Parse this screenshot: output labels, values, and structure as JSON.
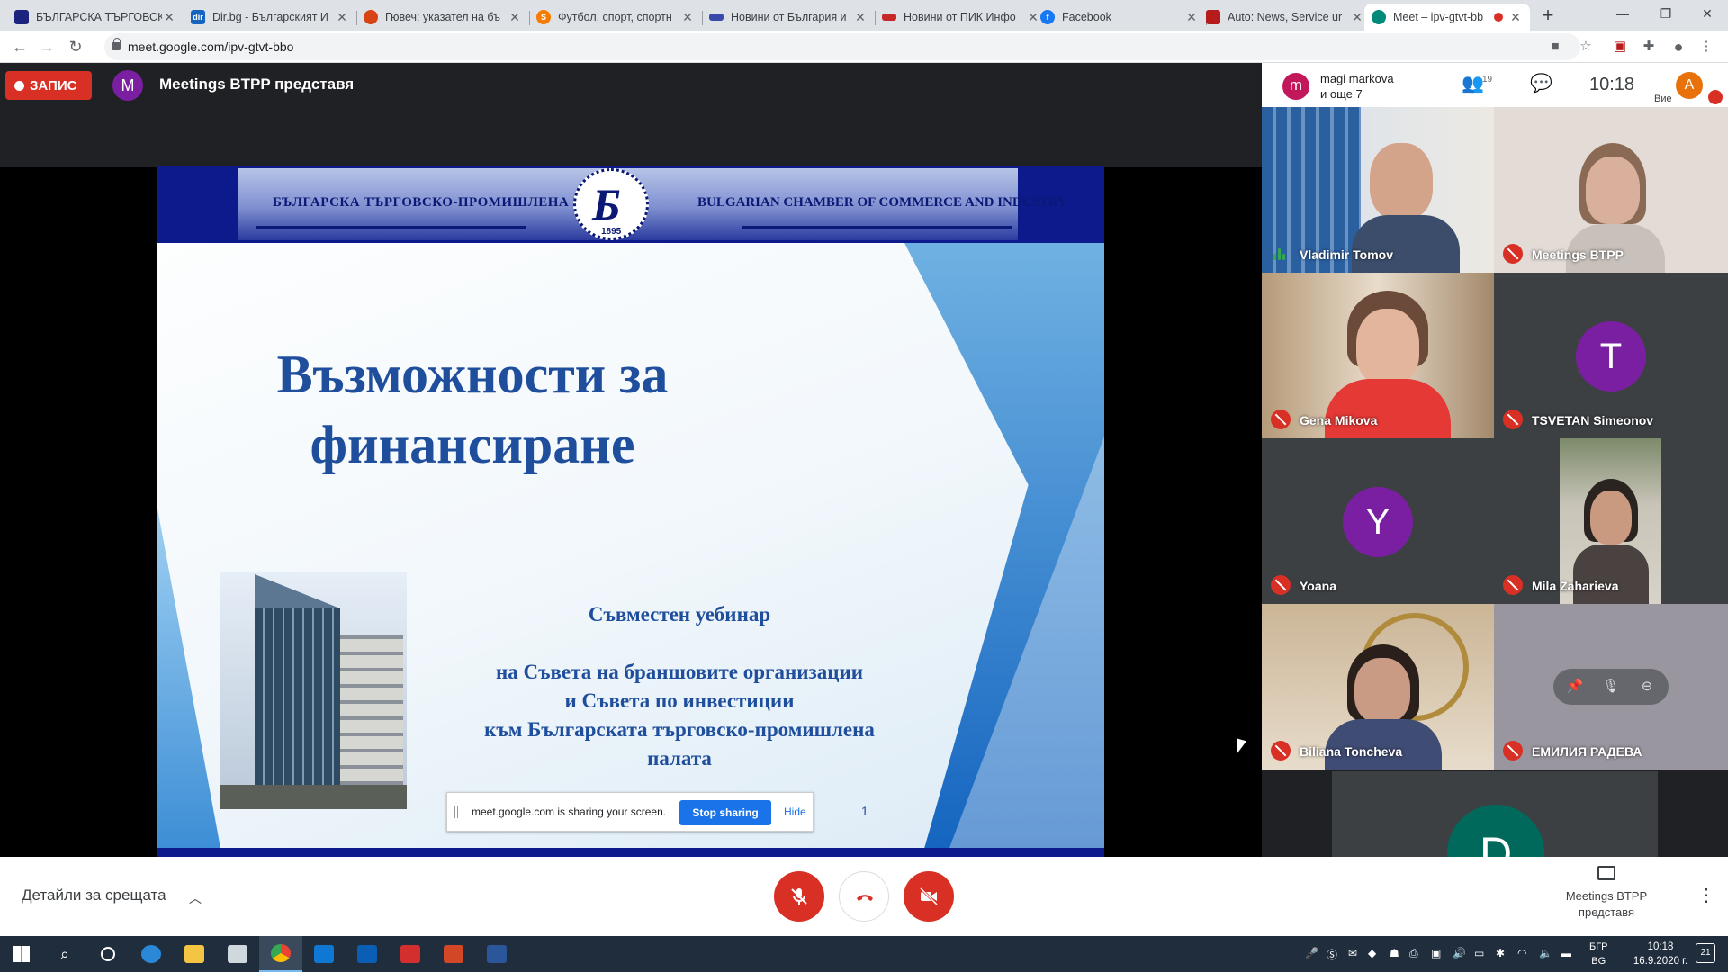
{
  "browser": {
    "tabs": [
      {
        "label": "БЪЛГАРСКА ТЪРГОВСКО",
        "fav_color": "#1a237e",
        "fav_text": ""
      },
      {
        "label": "Dir.bg - Българският И",
        "fav_color": "#1565c0",
        "fav_text": "dir"
      },
      {
        "label": "Гювеч: указател на бъ",
        "fav_color": "#d84315",
        "fav_text": ""
      },
      {
        "label": "Футбол, спорт, спортн",
        "fav_color": "#f57c00",
        "fav_text": "S"
      },
      {
        "label": "Новини от България и",
        "fav_color": "#3949ab",
        "fav_text": ""
      },
      {
        "label": "Новини от ПИК Инфо",
        "fav_color": "#c62828",
        "fav_text": ""
      },
      {
        "label": "Facebook",
        "fav_color": "#1877f2",
        "fav_text": "f"
      },
      {
        "label": "Auto: News, Service ur",
        "fav_color": "#b71c1c",
        "fav_text": ""
      },
      {
        "label": "Meet – ipv-gtvt-bb",
        "fav_color": "#00897b",
        "fav_text": ""
      }
    ],
    "new_tab": "+",
    "url": "meet.google.com/ipv-gtvt-bbo"
  },
  "meet": {
    "record_label": "ЗАПИС",
    "presenter_initial": "M",
    "presenting_text": "Meetings BTPP представя",
    "pinned_initial": "m",
    "pinned_line1": "magi markova",
    "pinned_line2": "и още 7",
    "people_count": "19",
    "time": "10:18",
    "you_initial": "A",
    "you_label": "Вие"
  },
  "slide": {
    "header_bg": "БЪЛГАРСКА ТЪРГОВСКО-ПРОМИШЛЕНА ПАЛАТА",
    "header_en": "BULGARIAN CHAMBER OF COMMERCE AND INDUSTRY",
    "seal_year": "1895",
    "title_line1": "Възможности за",
    "title_line2": "финансиране",
    "sub_heading": "Съвместен уебинар",
    "sub_line1": "на Съвета на браншовите организации",
    "sub_line2": "и Съвета по инвестиции",
    "sub_line3": "към Българската търговско-промишлена",
    "sub_line4": "палата",
    "page_number": "1"
  },
  "sharebar": {
    "message": "meet.google.com is sharing your screen.",
    "stop_label": "Stop sharing",
    "hide_label": "Hide"
  },
  "participants": [
    {
      "name": "Vladimir Tomov"
    },
    {
      "name": "Meetings BTPP"
    },
    {
      "name": "Gena Mikova"
    },
    {
      "name": "TSVETAN Simeonov",
      "initial": "T"
    },
    {
      "name": "Yoana",
      "initial": "Y"
    },
    {
      "name": "Mila Zaharieva"
    },
    {
      "name": "Biliana Toncheva"
    },
    {
      "name": "ЕМИЛИЯ РАДЕВА"
    },
    {
      "name": "",
      "initial": "D"
    }
  ],
  "bottom": {
    "details_label": "Детайли за срещата",
    "present_line1": "Meetings BTPP",
    "present_line2": "представя"
  },
  "taskbar": {
    "lang_top": "БГР",
    "lang_bottom": "BG",
    "clock_time": "10:18",
    "clock_date": "16.9.2020 г.",
    "notifications": "21"
  },
  "colors": {
    "meet_red": "#d93025",
    "meet_blue": "#1a73e8",
    "slide_blue": "#1f4e9c",
    "header_navy": "#0d1a8c"
  }
}
